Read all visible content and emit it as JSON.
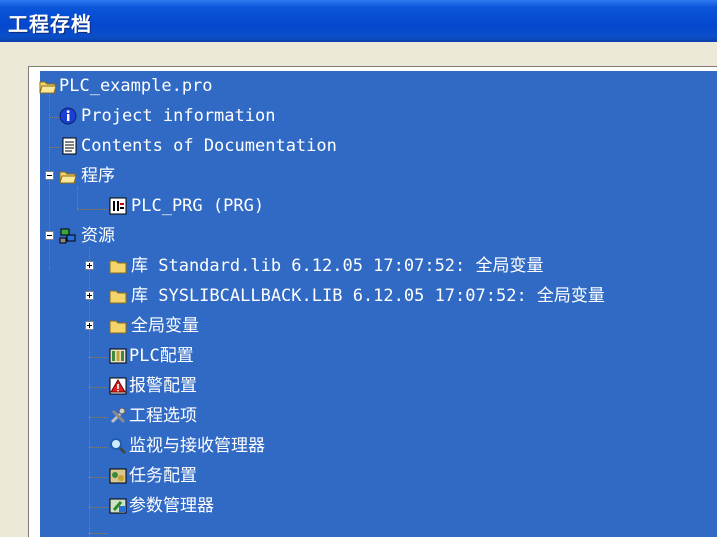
{
  "window": {
    "title": "工程存档"
  },
  "tree": {
    "root": {
      "label": "PLC_example.pro",
      "icon": "folder-open-icon"
    },
    "items": [
      {
        "label": "Project information",
        "icon": "info-icon"
      },
      {
        "label": "Contents of Documentation",
        "icon": "document-icon"
      },
      {
        "label": "程序",
        "icon": "folder-open-icon"
      },
      {
        "label": "PLC_PRG (PRG)",
        "icon": "program-icon"
      },
      {
        "label": "资源",
        "icon": "resources-icon"
      },
      {
        "label": "库 Standard.lib 6.12.05 17:07:52: 全局变量",
        "icon": "folder-icon"
      },
      {
        "label": "库 SYSLIBCALLBACK.LIB 6.12.05 17:07:52: 全局变量",
        "icon": "folder-icon"
      },
      {
        "label": "全局变量",
        "icon": "folder-icon"
      },
      {
        "label": "PLC配置",
        "icon": "plc-config-icon"
      },
      {
        "label": "报警配置",
        "icon": "alarm-icon"
      },
      {
        "label": "工程选项",
        "icon": "tools-icon"
      },
      {
        "label": "监视与接收管理器",
        "icon": "magnifier-icon"
      },
      {
        "label": "任务配置",
        "icon": "task-icon"
      },
      {
        "label": "参数管理器",
        "icon": "parameter-icon"
      }
    ]
  }
}
